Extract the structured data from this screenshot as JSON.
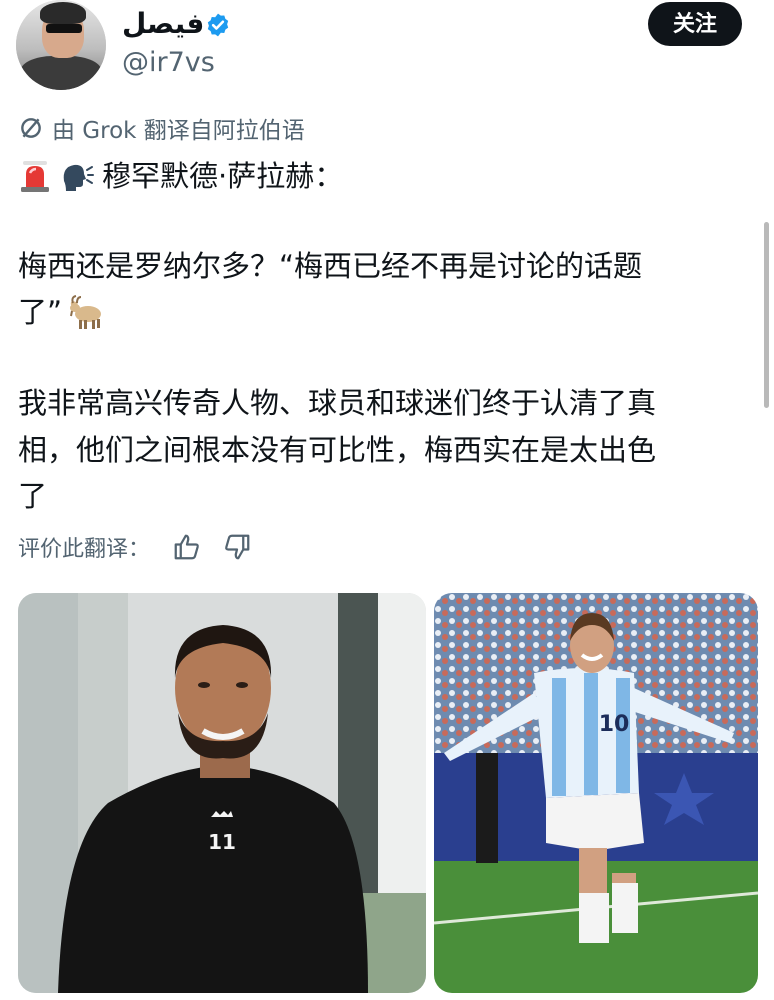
{
  "author": {
    "display_name": "فيصل",
    "handle": "@ir7vs",
    "verified": true,
    "follow_label": "关注"
  },
  "translation_note": {
    "icon": "translate-icon",
    "label": "由 Grok 翻译自阿拉伯语"
  },
  "tweet": {
    "emoji_1": "police-light-emoji",
    "emoji_2": "speaking-head-emoji",
    "speaker": "穆罕默德·萨拉赫：",
    "line_2": "梅西还是罗纳尔多？“梅西已经不再是讨论的话题",
    "line_3": "了”",
    "emoji_3": "goat-emoji",
    "line_4": "我非常高兴传奇人物、球员和球迷们终于认清了真",
    "line_5": "相，他们之间根本没有可比性，梅西实在是太出色",
    "line_6": "了"
  },
  "rating": {
    "label": "评价此翻译：",
    "thumbs_up_icon": "thumbs-up-icon",
    "thumbs_down_icon": "thumbs-down-icon"
  },
  "media": {
    "left_shirt_number": "11",
    "right_shirt_number": "10"
  },
  "colors": {
    "text": "#0f1419",
    "muted": "#536471",
    "verified_blue": "#1d9bf0",
    "button_bg": "#0f1419"
  }
}
